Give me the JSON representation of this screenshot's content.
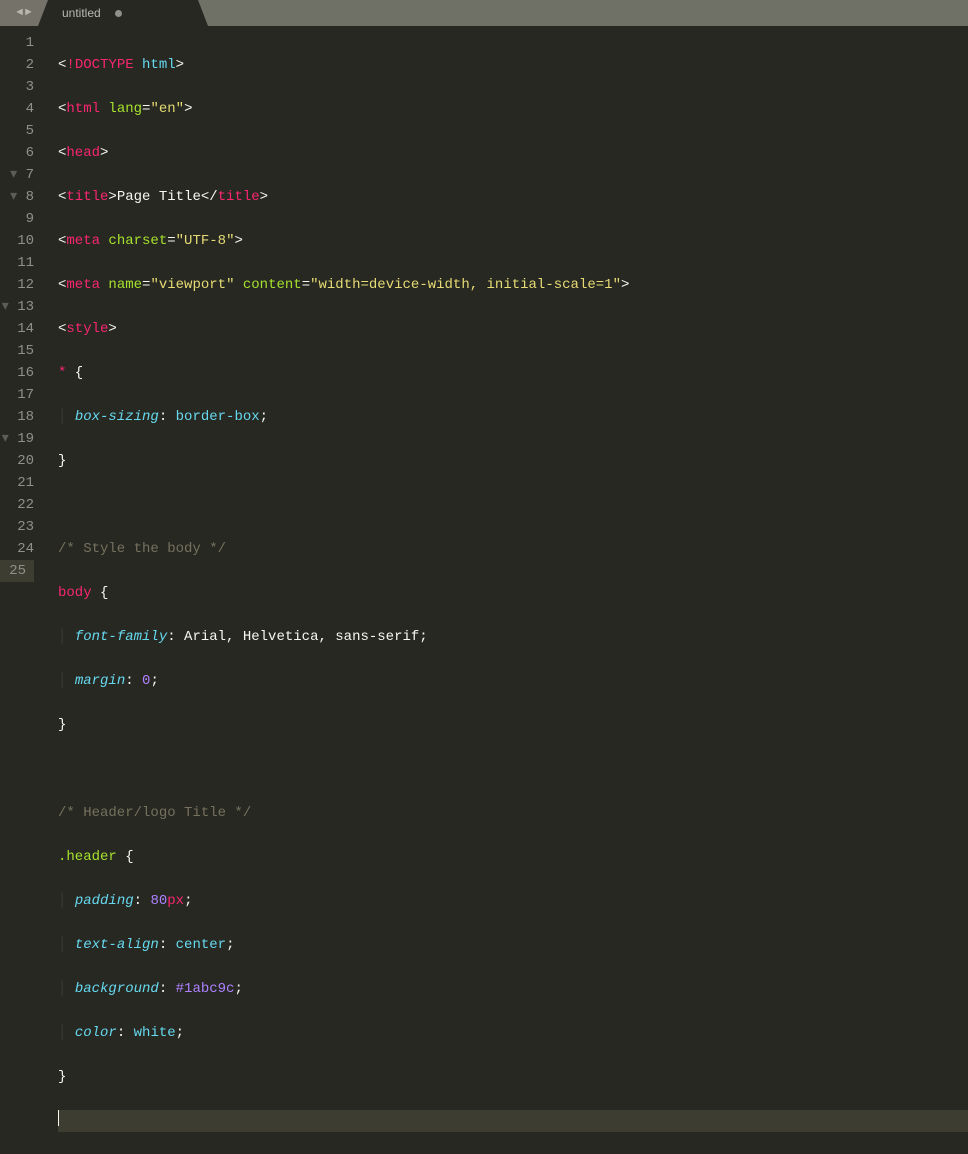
{
  "tab": {
    "title": "untitled",
    "dirty": true
  },
  "nav": {
    "back": "◄",
    "forward": "►"
  },
  "lines": [
    1,
    2,
    3,
    4,
    5,
    6,
    7,
    8,
    9,
    10,
    11,
    12,
    13,
    14,
    15,
    16,
    17,
    18,
    19,
    20,
    21,
    22,
    23,
    24,
    25
  ],
  "code": {
    "l1": {
      "lt": "<",
      "bang": "!",
      "doctype": "DOCTYPE",
      "sp": " ",
      "html": "html",
      "gt": ">"
    },
    "l2": {
      "lt": "<",
      "tag": "html",
      "sp": " ",
      "attr": "lang",
      "eq": "=",
      "q": "\"",
      "val": "en",
      "gt": ">"
    },
    "l3": {
      "lt": "<",
      "tag": "head",
      "gt": ">"
    },
    "l4": {
      "lt": "<",
      "tag": "title",
      "gt": ">",
      "text": "Page Title",
      "lt2": "</",
      "tag2": "title",
      "gt2": ">"
    },
    "l5": {
      "lt": "<",
      "tag": "meta",
      "sp": " ",
      "attr": "charset",
      "eq": "=",
      "q": "\"",
      "val": "UTF-8",
      "gt": ">"
    },
    "l6": {
      "lt": "<",
      "tag": "meta",
      "sp": " ",
      "attr1": "name",
      "eq": "=",
      "q": "\"",
      "val1": "viewport",
      "attr2": "content",
      "val2": "width=device-width, initial-scale=1",
      "gt": ">"
    },
    "l7": {
      "lt": "<",
      "tag": "style",
      "gt": ">"
    },
    "l8": {
      "sel": "*",
      "ob": " {"
    },
    "l9": {
      "prop": "box-sizing",
      "colon": ": ",
      "val": "border-box",
      "semi": ";"
    },
    "l10": {
      "cb": "}"
    },
    "l11": "",
    "l12": {
      "c": "/* Style the body */"
    },
    "l13": {
      "sel": "body",
      "ob": " {"
    },
    "l14": {
      "prop": "font-family",
      "colon": ": ",
      "val": "Arial, Helvetica, sans-serif",
      "semi": ";"
    },
    "l15": {
      "prop": "margin",
      "colon": ": ",
      "val": "0",
      "semi": ";"
    },
    "l16": {
      "cb": "}"
    },
    "l17": "",
    "l18": {
      "c": "/* Header/logo Title */"
    },
    "l19": {
      "sel": ".header",
      "ob": " {"
    },
    "l20": {
      "prop": "padding",
      "colon": ": ",
      "val": "80px",
      "semi": ";"
    },
    "l21": {
      "prop": "text-align",
      "colon": ": ",
      "val": "center",
      "semi": ";"
    },
    "l22": {
      "prop": "background",
      "colon": ": ",
      "val": "#1abc9c",
      "semi": ";"
    },
    "l23": {
      "prop": "color",
      "colon": ": ",
      "val": "white",
      "semi": ";"
    },
    "l24": {
      "cb": "}"
    },
    "l25": ""
  }
}
